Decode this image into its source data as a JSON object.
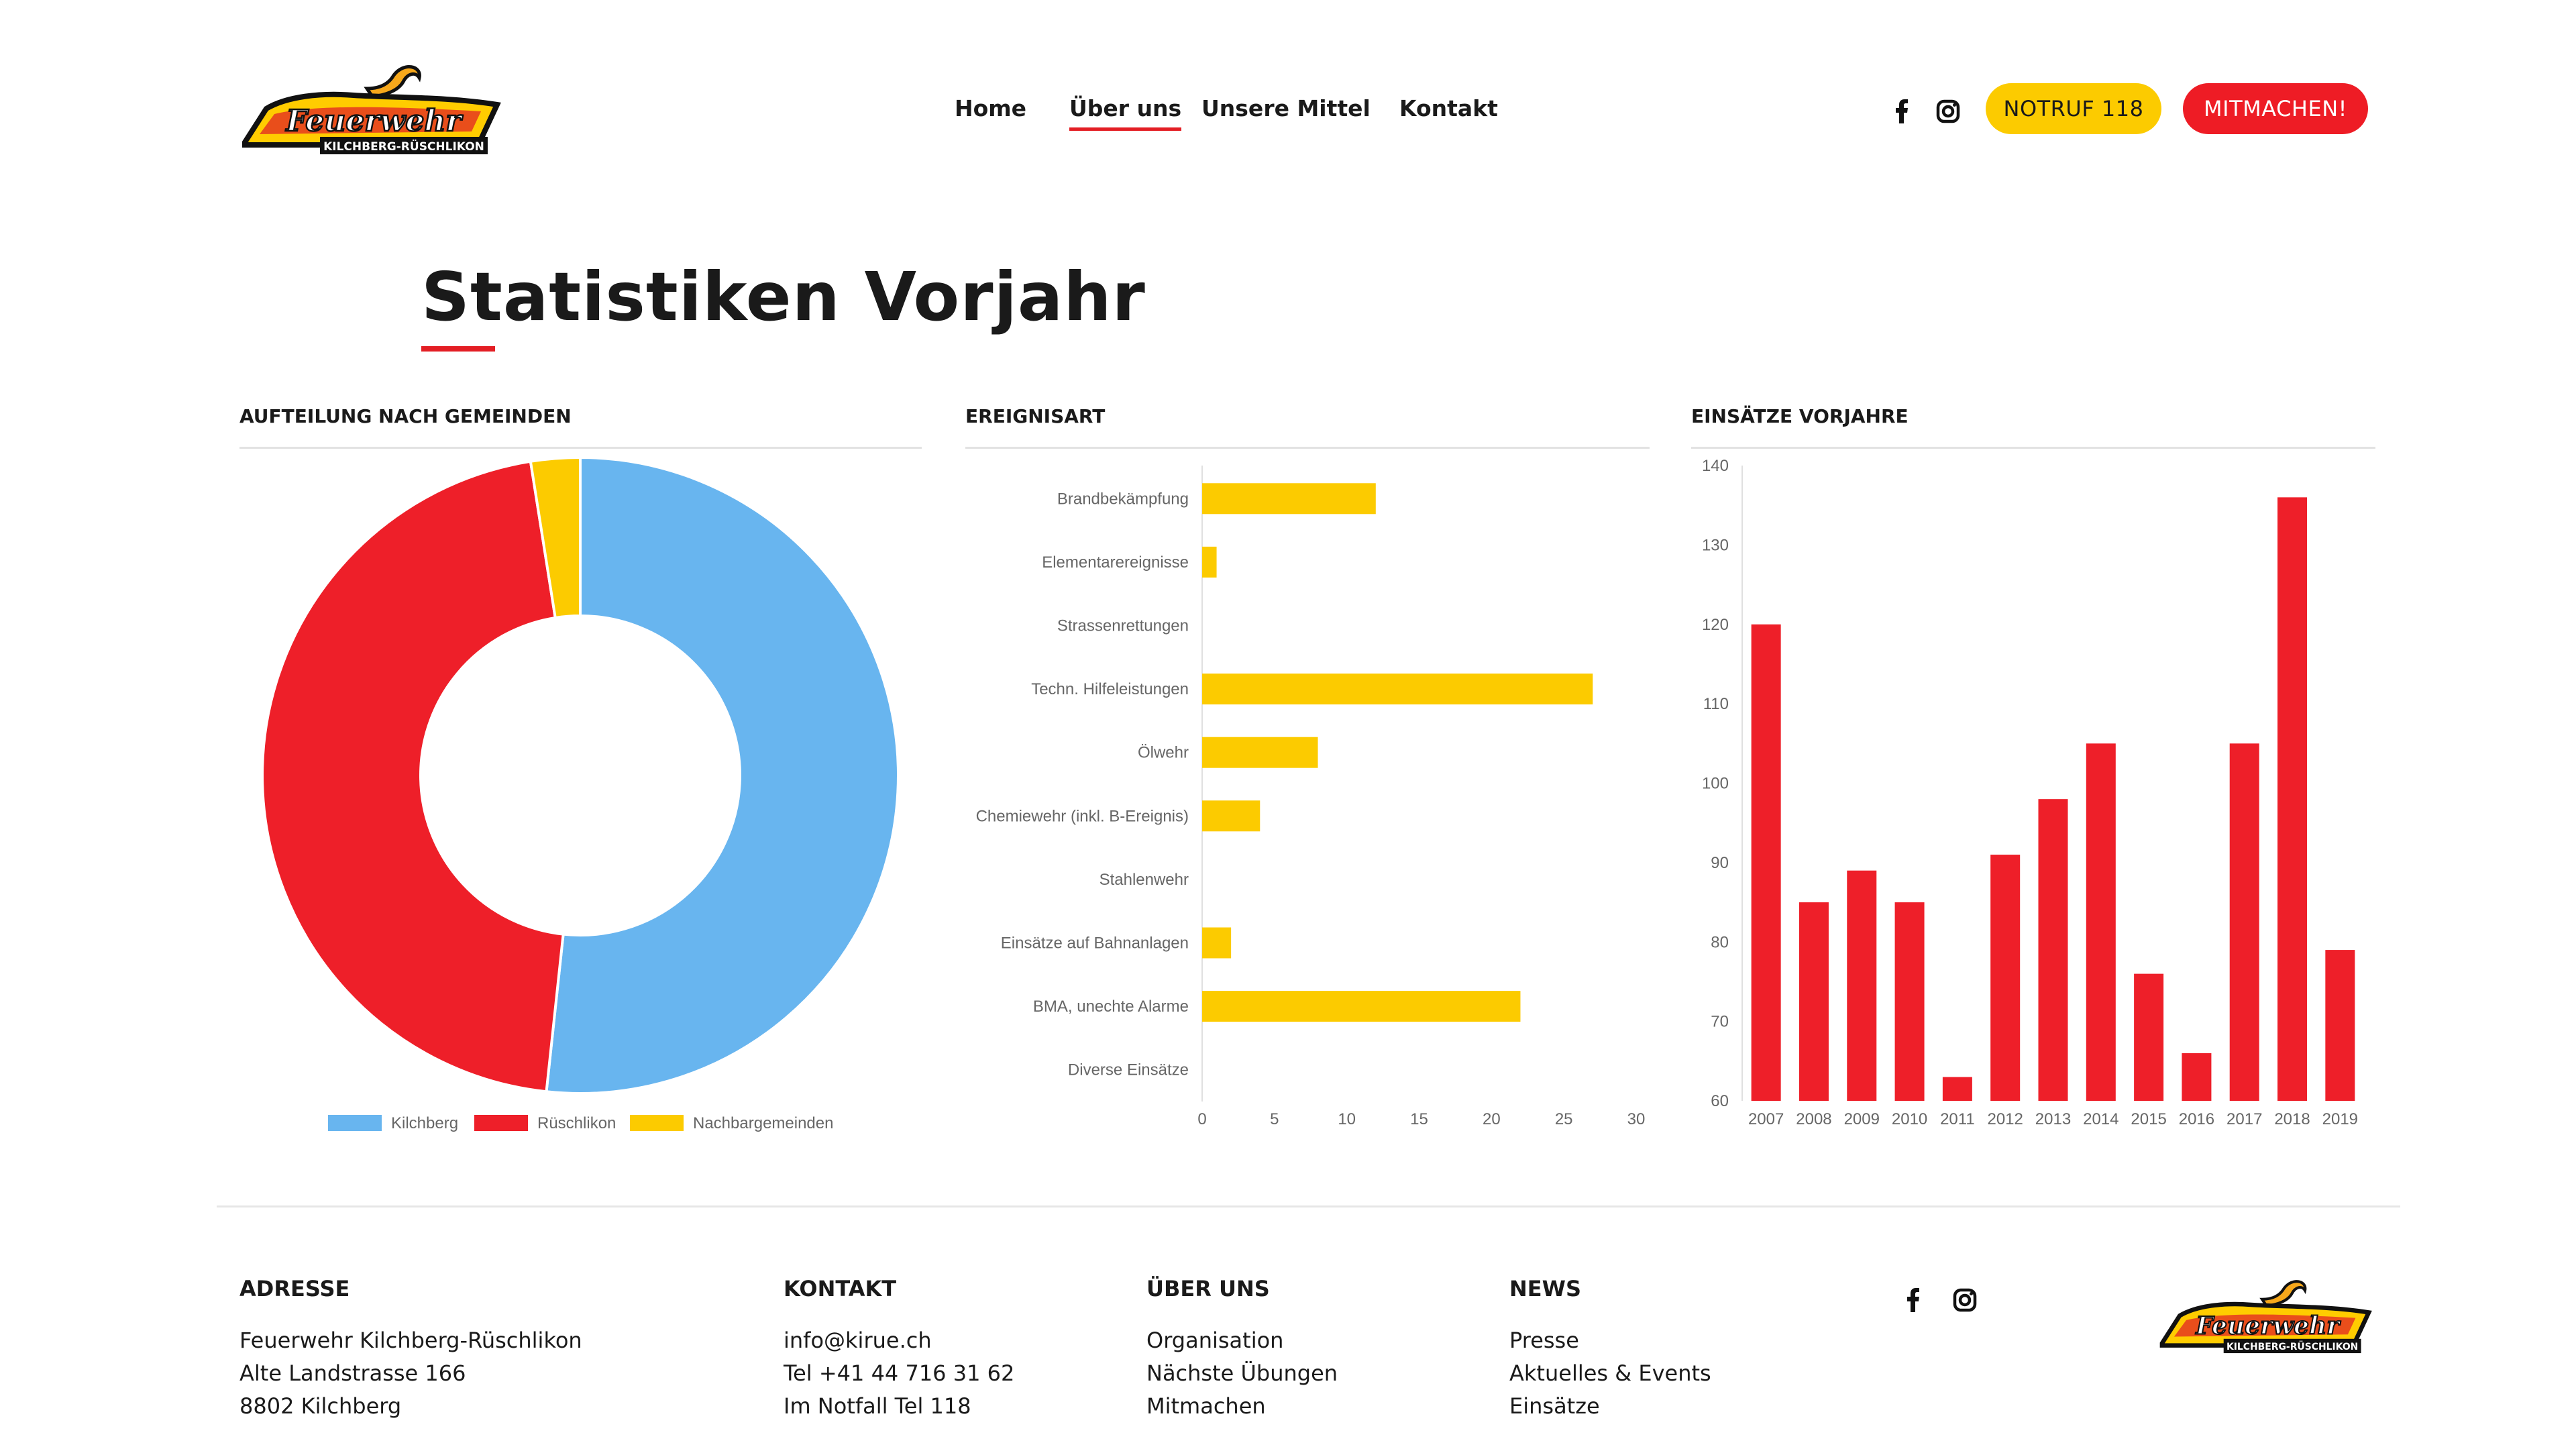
{
  "header": {
    "logo_alt": "Feuerwehr Kilchberg-Rüschlikon",
    "logo_word": "Feuerwehr",
    "logo_sub": "KILCHBERG-RÜSCHLIKON",
    "nav": [
      {
        "label": "Home",
        "active": false
      },
      {
        "label": "Über uns",
        "active": true
      },
      {
        "label": "Unsere Mittel",
        "active": false
      },
      {
        "label": "Kontakt",
        "active": false
      }
    ],
    "social": [
      {
        "icon": "facebook-icon"
      },
      {
        "icon": "instagram-icon"
      }
    ],
    "notruf_label": "NOTRUF 118",
    "mitmachen_label": "MITMACHEN!",
    "colors": {
      "yellow": "#fccb00",
      "red": "#ee1c25",
      "accent_underline": "#e31e24"
    }
  },
  "main": {
    "title": "Statistiken Vorjahr",
    "sections": [
      {
        "heading": "AUFTEILUNG NACH GEMEINDEN"
      },
      {
        "heading": "EREIGNISART"
      },
      {
        "heading": "EINSÄTZE VORJAHRE"
      }
    ]
  },
  "chart_data": [
    {
      "type": "pie",
      "variant": "donut",
      "title": "",
      "labels": [
        "Kilchberg",
        "Rüschlikon",
        "Nachbargemeinden"
      ],
      "values": [
        51.7,
        45.8,
        2.5
      ],
      "colors": [
        "#68b5ef",
        "#ee1f29",
        "#fccb00"
      ],
      "legend": "bottom"
    },
    {
      "type": "bar",
      "orientation": "horizontal",
      "title": "",
      "categories": [
        "Brandbekämpfung",
        "Elementarereignisse",
        "Strassenrettungen",
        "Techn. Hilfeleistungen",
        "Ölwehr",
        "Chemiewehr (inkl. B-Ereignis)",
        "Stahlenwehr",
        "Einsätze auf Bahnanlagen",
        "BMA, unechte Alarme",
        "Diverse Einsätze"
      ],
      "values": [
        12,
        1,
        0,
        27,
        8,
        4,
        0,
        2,
        22,
        0
      ],
      "xlim": [
        0,
        30
      ],
      "xticks": [
        0,
        5,
        10,
        15,
        20,
        25,
        30
      ],
      "color": "#fccb00",
      "grid": false
    },
    {
      "type": "bar",
      "title": "",
      "categories": [
        "2007",
        "2008",
        "2009",
        "2010",
        "2011",
        "2012",
        "2013",
        "2014",
        "2015",
        "2016",
        "2017",
        "2018",
        "2019"
      ],
      "values": [
        120,
        85,
        89,
        85,
        63,
        91,
        98,
        105,
        76,
        66,
        105,
        136,
        79
      ],
      "ylim": [
        60,
        140
      ],
      "yticks": [
        60,
        70,
        80,
        90,
        100,
        110,
        120,
        130,
        140
      ],
      "color": "#ee1f29",
      "grid": false
    }
  ],
  "footer": {
    "columns": [
      {
        "heading": "ADRESSE",
        "lines": [
          "Feuerwehr Kilchberg-Rüschlikon",
          "Alte Landstrasse 166",
          "8802 Kilchberg"
        ]
      },
      {
        "heading": "KONTAKT",
        "lines": [
          "info@kirue.ch",
          "Tel +41 44 716 31 62",
          "Im Notfall Tel 118"
        ]
      },
      {
        "heading": "ÜBER UNS",
        "lines": [
          "Organisation",
          "Nächste Übungen",
          "Mitmachen"
        ]
      },
      {
        "heading": "NEWS",
        "lines": [
          "Presse",
          "Aktuelles & Events",
          "Einsätze"
        ]
      }
    ]
  }
}
